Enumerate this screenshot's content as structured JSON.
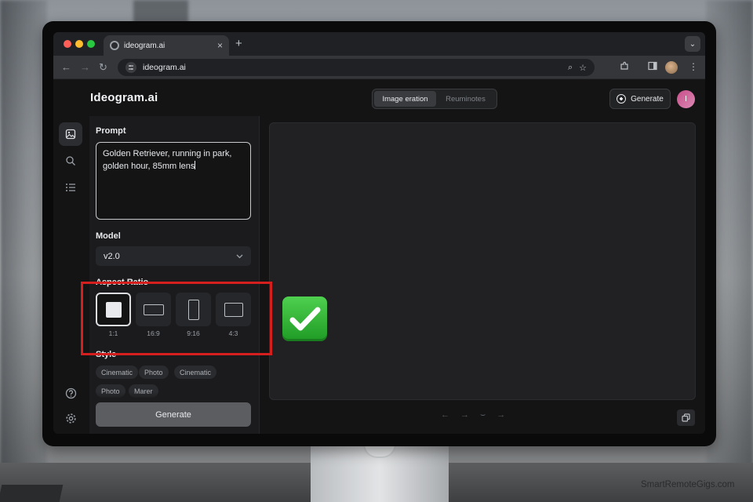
{
  "browser": {
    "tab_title": "ideogram.ai",
    "tab_close": "×",
    "new_tab": "+",
    "tab_menu": "⌄",
    "url": "ideogram.ai",
    "nav_back": "←",
    "nav_forward": "→",
    "nav_reload": "↻",
    "zoom_icon": "⌕",
    "star_icon": "☆",
    "menu_icon": "⋮"
  },
  "header": {
    "brand": "Ideogram.ai",
    "tabs": [
      {
        "label": "Image eration",
        "active": true
      },
      {
        "label": "Reuminotes",
        "active": false
      }
    ],
    "generate_label": "Generate",
    "avatar_initial": "I"
  },
  "panel": {
    "prompt_label": "Prompt",
    "prompt_lines": [
      "Golden Retriever, running in park,",
      "golden hour, 85mm lens"
    ],
    "model_label": "Model",
    "model_value": "v2.0",
    "aspect_label": "Aspect Ratio",
    "ratios": [
      {
        "label": "1:1",
        "selected": true
      },
      {
        "label": "16:9",
        "selected": false
      },
      {
        "label": "9:16",
        "selected": false
      },
      {
        "label": "4:3",
        "selected": false
      }
    ],
    "style_label": "Style",
    "styles": [
      "Cinematic",
      "Photo",
      "Cinematic",
      "Photo",
      "Marer"
    ],
    "generate_label": "Generate"
  },
  "canvas": {
    "controls": [
      "←",
      "→",
      "⌣",
      "→"
    ]
  },
  "colors": {
    "highlight": "#d51e1e",
    "check_badge": "#2fb533",
    "avatar": "#c94e8a"
  },
  "watermark": "SmartRemoteGigs.com"
}
